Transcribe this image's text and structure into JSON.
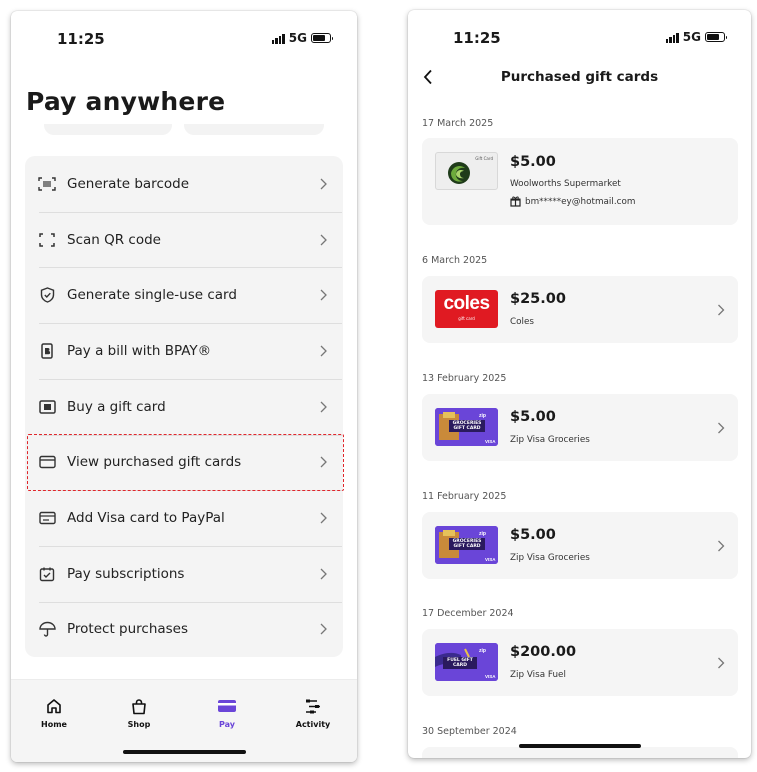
{
  "left_screen": {
    "status": {
      "time": "11:25",
      "network": "5G"
    },
    "title": "Pay anywhere",
    "menu_items": [
      {
        "label": "Generate barcode",
        "icon": "barcode-scan-icon"
      },
      {
        "label": "Scan QR code",
        "icon": "qr-scan-icon"
      },
      {
        "label": "Generate single-use card",
        "icon": "shield-check-icon"
      },
      {
        "label": "Pay a bill with BPAY®",
        "icon": "bpay-icon"
      },
      {
        "label": "Buy a gift card",
        "icon": "gift-card-icon"
      },
      {
        "label": "View purchased gift cards",
        "icon": "wallet-card-icon"
      },
      {
        "label": "Add Visa card to PayPal",
        "icon": "card-link-icon"
      },
      {
        "label": "Pay subscriptions",
        "icon": "calendar-check-icon"
      },
      {
        "label": "Protect purchases",
        "icon": "umbrella-icon"
      }
    ],
    "tabs": [
      {
        "label": "Home",
        "icon": "home-icon"
      },
      {
        "label": "Shop",
        "icon": "shopping-bag-icon"
      },
      {
        "label": "Pay",
        "icon": "pay-card-icon",
        "active": true
      },
      {
        "label": "Activity",
        "icon": "activity-icon"
      }
    ],
    "accent_color": "#6a45d8",
    "highlight_color": "#e0262b"
  },
  "right_screen": {
    "status": {
      "time": "11:25",
      "network": "5G"
    },
    "title": "Purchased gift cards",
    "groups": [
      {
        "date": "17 March 2025",
        "amount": "$5.00",
        "merchant": "Woolworths Supermarket",
        "recipient": "bm*****ey@hotmail.com",
        "thumb": "woolworths",
        "thumb_text": "Gift Card"
      },
      {
        "date": "6 March 2025",
        "amount": "$25.00",
        "merchant": "Coles",
        "thumb": "coles",
        "thumb_text": "coles",
        "thumb_sub": "gift card"
      },
      {
        "date": "13 February 2025",
        "amount": "$5.00",
        "merchant": "Zip Visa Groceries",
        "thumb": "zip-groceries",
        "thumb_text": "GROCERIES GIFT CARD"
      },
      {
        "date": "11 February 2025",
        "amount": "$5.00",
        "merchant": "Zip Visa Groceries",
        "thumb": "zip-groceries",
        "thumb_text": "GROCERIES GIFT CARD"
      },
      {
        "date": "17 December 2024",
        "amount": "$200.00",
        "merchant": "Zip Visa Fuel",
        "thumb": "zip-fuel",
        "thumb_text": "FUEL GIFT CARD"
      }
    ],
    "trailing_date": "30 September 2024",
    "coles_red": "#e01a22",
    "zip_purple": "#6a45d8"
  }
}
